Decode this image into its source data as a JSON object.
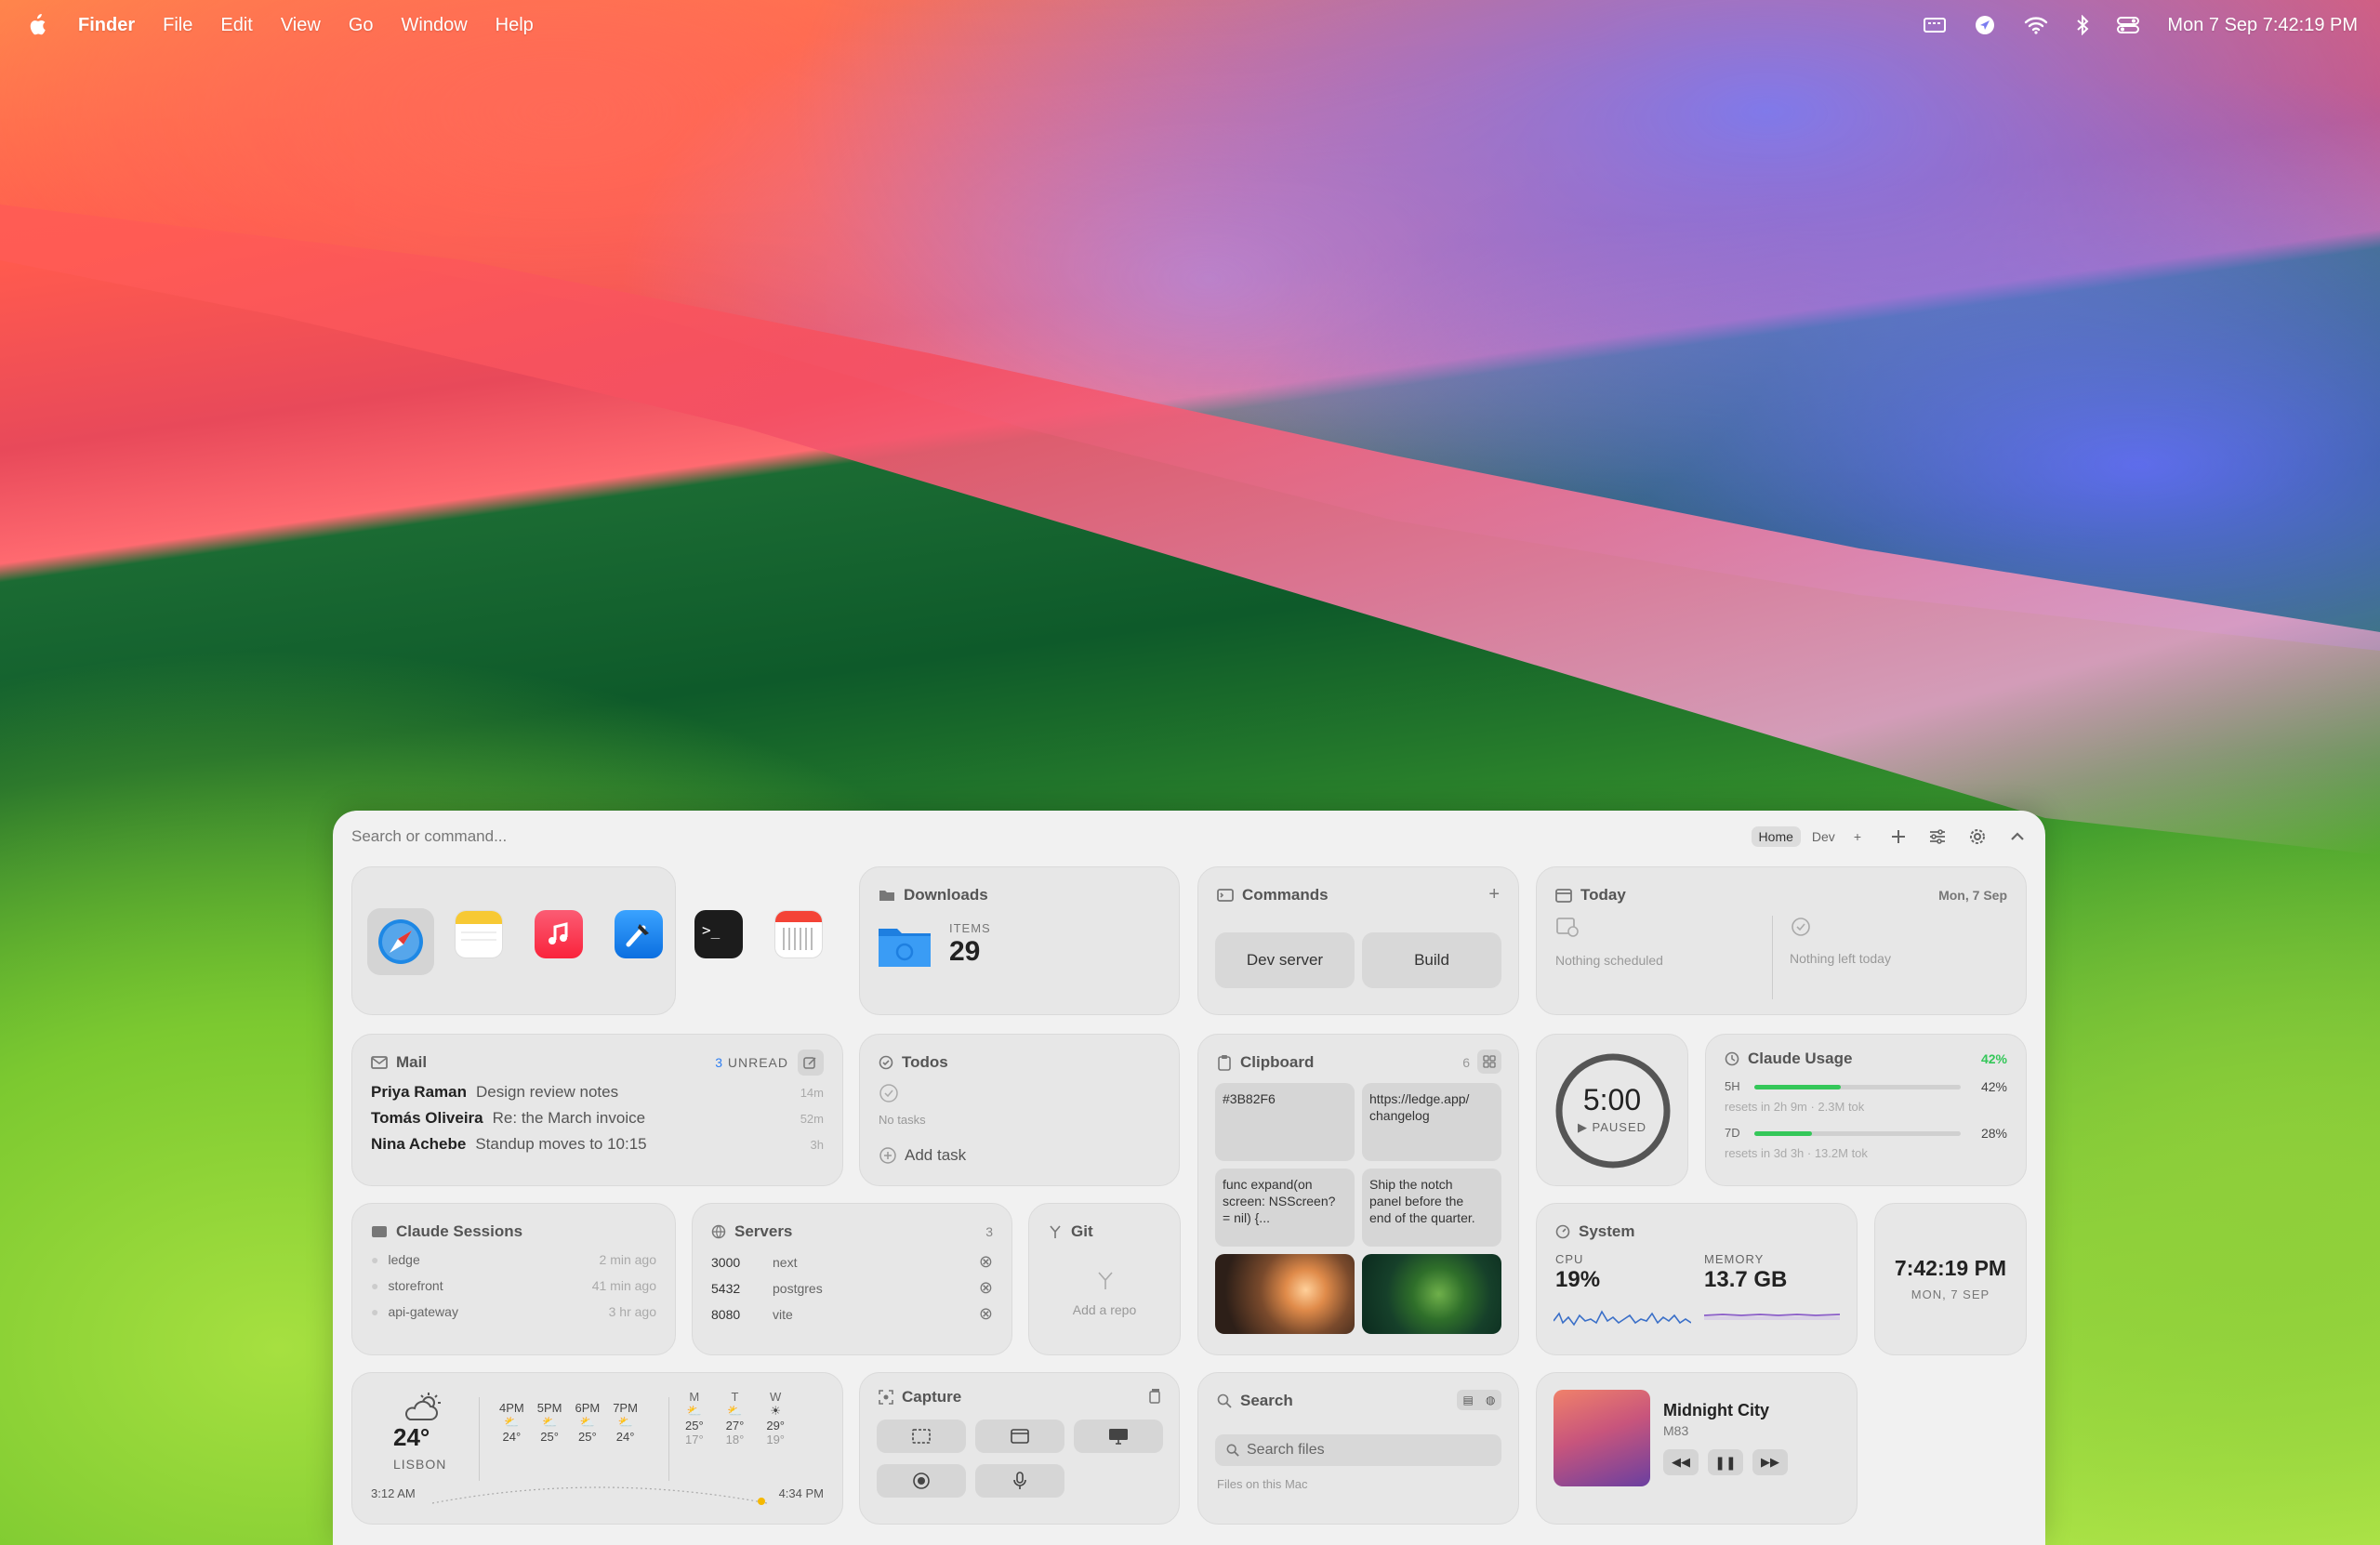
{
  "menubar": {
    "app": "Finder",
    "items": [
      "File",
      "Edit",
      "View",
      "Go",
      "Window",
      "Help"
    ],
    "datetime": "Mon 7 Sep  7:42:19 PM"
  },
  "topbar": {
    "search_placeholder": "Search or command...",
    "tabs": [
      "Home",
      "Dev",
      "+"
    ]
  },
  "downloads": {
    "title": "Downloads",
    "items_label": "ITEMS",
    "count": "29"
  },
  "commands": {
    "title": "Commands",
    "add": "+",
    "buttons": [
      "Dev server",
      "Build"
    ]
  },
  "today": {
    "title": "Today",
    "date": "Mon, 7 Sep",
    "left": "Nothing scheduled",
    "right": "Nothing left today"
  },
  "mail": {
    "title": "Mail",
    "unread_count": "3",
    "unread_label": "UNREAD",
    "messages": [
      {
        "from": "Priya Raman",
        "subject": "Design review notes",
        "time": "14m"
      },
      {
        "from": "Tomás Oliveira",
        "subject": "Re: the March invoice",
        "time": "52m"
      },
      {
        "from": "Nina Achebe",
        "subject": "Standup moves to 10:15",
        "time": "3h"
      }
    ]
  },
  "todos": {
    "title": "Todos",
    "empty": "No tasks",
    "add": "Add task"
  },
  "clipboard": {
    "title": "Clipboard",
    "count": "6",
    "items": [
      "#3B82F6",
      "https://ledge.app/\nchangelog",
      "func expand(on\nscreen: NSScreen?\n= nil) {...",
      "Ship the notch\npanel before the\nend of the quarter."
    ]
  },
  "timer": {
    "time": "5:00",
    "state": "PAUSED"
  },
  "claude_usage": {
    "title": "Claude Usage",
    "headline": "42%",
    "rows": [
      {
        "label": "5H",
        "percent": "42%",
        "value": 0.42,
        "note": "resets in 2h 9m · 2.3M tok"
      },
      {
        "label": "7D",
        "percent": "28%",
        "value": 0.28,
        "note": "resets in 3d 3h · 13.2M tok"
      }
    ]
  },
  "sessions": {
    "title": "Claude Sessions",
    "items": [
      {
        "name": "ledge",
        "time": "2 min ago"
      },
      {
        "name": "storefront",
        "time": "41 min ago"
      },
      {
        "name": "api-gateway",
        "time": "3 hr ago"
      }
    ]
  },
  "servers": {
    "title": "Servers",
    "count": "3",
    "items": [
      {
        "port": "3000",
        "name": "next"
      },
      {
        "port": "5432",
        "name": "postgres"
      },
      {
        "port": "8080",
        "name": "vite"
      }
    ]
  },
  "git": {
    "title": "Git",
    "empty": "Add a repo"
  },
  "system": {
    "title": "System",
    "cpu_label": "CPU",
    "cpu": "19%",
    "mem_label": "MEMORY",
    "mem": "13.7 GB"
  },
  "clock": {
    "time": "7:42:19 PM",
    "date": "MON, 7 SEP"
  },
  "weather": {
    "temp": "24°",
    "city": "LISBON",
    "hourly": [
      {
        "h": "4PM",
        "t": "24°"
      },
      {
        "h": "5PM",
        "t": "25°"
      },
      {
        "h": "6PM",
        "t": "25°"
      },
      {
        "h": "7PM",
        "t": "24°"
      }
    ],
    "daily": [
      {
        "d": "M",
        "hi": "25°",
        "lo": "17°"
      },
      {
        "d": "T",
        "hi": "27°",
        "lo": "18°"
      },
      {
        "d": "W",
        "hi": "29°",
        "lo": "19°"
      }
    ],
    "sunrise": "3:12 AM",
    "sunset": "4:34 PM"
  },
  "capture": {
    "title": "Capture"
  },
  "search": {
    "title": "Search",
    "placeholder": "Search files",
    "hint": "Files on this Mac"
  },
  "music": {
    "title": "Midnight City",
    "artist": "M83"
  }
}
